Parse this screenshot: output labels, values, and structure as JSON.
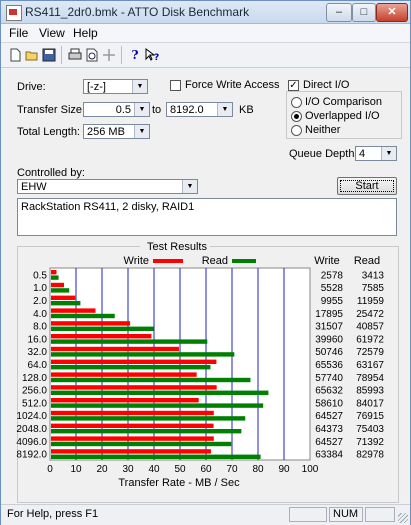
{
  "window": {
    "title": "RS411_2dr0.bmk - ATTO Disk Benchmark",
    "buttons": {
      "minimize": "–",
      "maximize": "□",
      "close": "✕"
    }
  },
  "menu": [
    "File",
    "View",
    "Help"
  ],
  "toolbar": {
    "icons": [
      "new-file-icon",
      "open-folder-icon",
      "save-icon",
      "print-icon",
      "print-preview-icon",
      "move-icon",
      "help-icon",
      "context-help-icon"
    ]
  },
  "form": {
    "drive_label": "Drive:",
    "drive_value": "[-z-]",
    "force_write_label": "Force Write Access",
    "force_write_checked": false,
    "direct_io_label": "Direct I/O",
    "direct_io_checked": true,
    "transfer_size_label": "Transfer Size:",
    "transfer_from": "0.5",
    "transfer_to_label": "to",
    "transfer_to": "8192.0",
    "transfer_unit": "KB",
    "total_length_label": "Total Length:",
    "total_length": "256 MB",
    "io_options": [
      "I/O Comparison",
      "Overlapped I/O",
      "Neither"
    ],
    "io_selected": 1,
    "queue_depth_label": "Queue Depth:",
    "queue_depth": "4",
    "controlled_by_label": "Controlled by:",
    "controlled_by_value": "EHW",
    "start_button": "Start",
    "description": "RackStation RS411, 2 disky, RAID1"
  },
  "results": {
    "group_title": "Test Results",
    "legend_write": "Write",
    "legend_read": "Read",
    "col_write": "Write",
    "col_read": "Read",
    "write_color": "#ff0000",
    "read_color": "#008000",
    "rows": [
      {
        "size": "0.5",
        "write": "2578",
        "read": "3413"
      },
      {
        "size": "1.0",
        "write": "5528",
        "read": "7585"
      },
      {
        "size": "2.0",
        "write": "9955",
        "read": "11959"
      },
      {
        "size": "4.0",
        "write": "17895",
        "read": "25472"
      },
      {
        "size": "8.0",
        "write": "31507",
        "read": "40857"
      },
      {
        "size": "16.0",
        "write": "39960",
        "read": "61972"
      },
      {
        "size": "32.0",
        "write": "50746",
        "read": "72579"
      },
      {
        "size": "64.0",
        "write": "65536",
        "read": "63167"
      },
      {
        "size": "128.0",
        "write": "57740",
        "read": "78954"
      },
      {
        "size": "256.0",
        "write": "65632",
        "read": "85993"
      },
      {
        "size": "512.0",
        "write": "58610",
        "read": "84017"
      },
      {
        "size": "1024.0",
        "write": "64527",
        "read": "76915"
      },
      {
        "size": "2048.0",
        "write": "64373",
        "read": "75403"
      },
      {
        "size": "4096.0",
        "write": "64527",
        "read": "71392"
      },
      {
        "size": "8192.0",
        "write": "63384",
        "read": "82978"
      }
    ]
  },
  "chart_data": {
    "type": "bar",
    "orientation": "horizontal",
    "categories": [
      "0.5",
      "1.0",
      "2.0",
      "4.0",
      "8.0",
      "16.0",
      "32.0",
      "64.0",
      "128.0",
      "256.0",
      "512.0",
      "1024.0",
      "2048.0",
      "4096.0",
      "8192.0"
    ],
    "series": [
      {
        "name": "Write",
        "values": [
          2.5,
          5.4,
          9.7,
          17.5,
          30.8,
          39.0,
          49.6,
          64.0,
          56.4,
          64.1,
          57.2,
          63.0,
          62.9,
          63.0,
          61.9
        ]
      },
      {
        "name": "Read",
        "values": [
          3.3,
          7.4,
          11.7,
          24.9,
          39.9,
          60.5,
          70.9,
          61.7,
          77.1,
          84.0,
          82.0,
          75.1,
          73.6,
          69.7,
          81.0
        ]
      }
    ],
    "xlabel": "Transfer Rate - MB / Sec",
    "xlim": [
      0,
      100
    ],
    "xticks": [
      "0",
      "10",
      "20",
      "30",
      "40",
      "50",
      "60",
      "70",
      "80",
      "90",
      "100"
    ],
    "grid": true
  },
  "status": {
    "help_text": "For Help, press F1",
    "num": "NUM"
  }
}
